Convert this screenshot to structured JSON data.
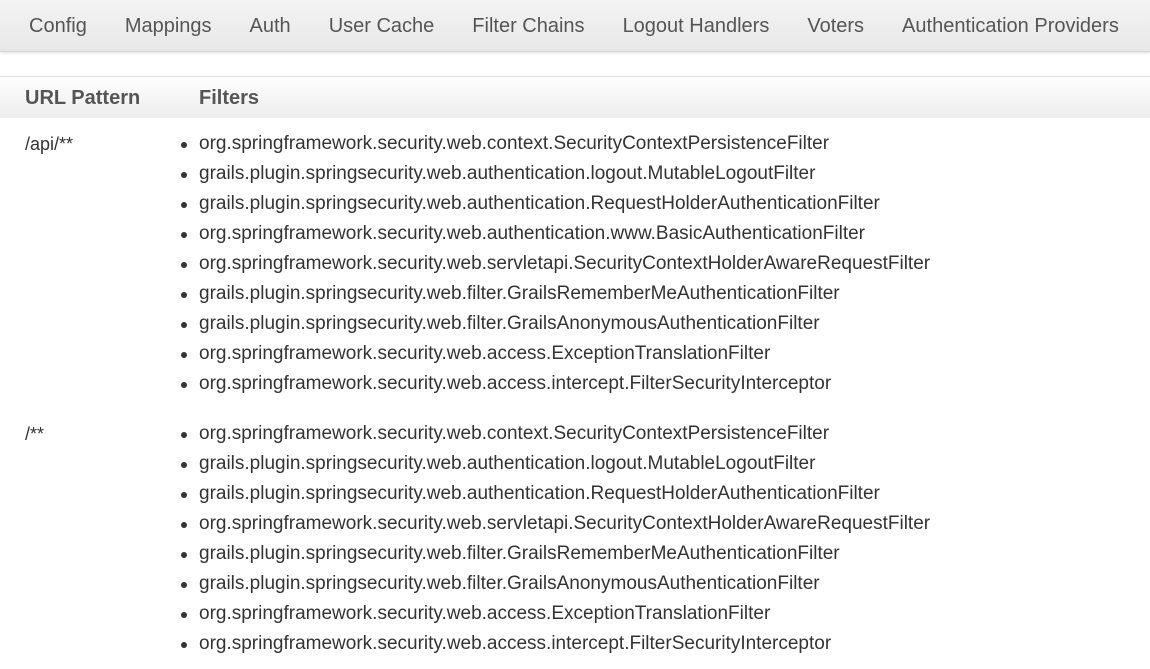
{
  "nav": {
    "items": [
      {
        "label": "Config"
      },
      {
        "label": "Mappings"
      },
      {
        "label": "Auth"
      },
      {
        "label": "User Cache"
      },
      {
        "label": "Filter Chains"
      },
      {
        "label": "Logout Handlers"
      },
      {
        "label": "Voters"
      },
      {
        "label": "Authentication Providers"
      }
    ]
  },
  "table": {
    "headers": {
      "pattern": "URL Pattern",
      "filters": "Filters"
    },
    "chains": [
      {
        "pattern": "/api/**",
        "filters": [
          "org.springframework.security.web.context.SecurityContextPersistenceFilter",
          "grails.plugin.springsecurity.web.authentication.logout.MutableLogoutFilter",
          "grails.plugin.springsecurity.web.authentication.RequestHolderAuthenticationFilter",
          "org.springframework.security.web.authentication.www.BasicAuthenticationFilter",
          "org.springframework.security.web.servletapi.SecurityContextHolderAwareRequestFilter",
          "grails.plugin.springsecurity.web.filter.GrailsRememberMeAuthenticationFilter",
          "grails.plugin.springsecurity.web.filter.GrailsAnonymousAuthenticationFilter",
          "org.springframework.security.web.access.ExceptionTranslationFilter",
          "org.springframework.security.web.access.intercept.FilterSecurityInterceptor"
        ]
      },
      {
        "pattern": "/**",
        "filters": [
          "org.springframework.security.web.context.SecurityContextPersistenceFilter",
          "grails.plugin.springsecurity.web.authentication.logout.MutableLogoutFilter",
          "grails.plugin.springsecurity.web.authentication.RequestHolderAuthenticationFilter",
          "org.springframework.security.web.servletapi.SecurityContextHolderAwareRequestFilter",
          "grails.plugin.springsecurity.web.filter.GrailsRememberMeAuthenticationFilter",
          "grails.plugin.springsecurity.web.filter.GrailsAnonymousAuthenticationFilter",
          "org.springframework.security.web.access.ExceptionTranslationFilter",
          "org.springframework.security.web.access.intercept.FilterSecurityInterceptor"
        ]
      }
    ]
  }
}
